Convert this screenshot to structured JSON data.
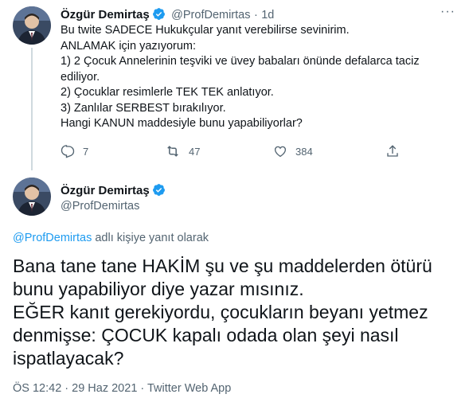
{
  "tweet1": {
    "name": "Özgür Demirtaş",
    "handle": "@ProfDemirtas",
    "separator": "·",
    "time": "1d",
    "lines": [
      "Bu twite SADECE Hukukçular yanıt verebilirse sevinirim.",
      "ANLAMAK için yazıyorum:",
      "1) 2 Çocuk Annelerinin teşviki ve üvey babaları önünde defalarca taciz",
      "ediliyor.",
      "2) Çocuklar resimlerle TEK TEK anlatıyor.",
      "3) Zanlılar SERBEST bırakılıyor.",
      "Hangi KANUN maddesiyle bunu yapabiliyorlar?"
    ],
    "reply_count": "7",
    "retweet_count": "47",
    "like_count": "384",
    "more_icon": "···"
  },
  "tweet2": {
    "name": "Özgür Demirtaş",
    "handle": "@ProfDemirtas",
    "reply_to_user": "@ProfDemirtas",
    "reply_to_suffix": "adlı kişiye yanıt olarak",
    "lines": [
      "Bana tane tane HAKİM şu ve şu maddelerden ötürü",
      "bunu yapabiliyor diye yazar mısınız.",
      "EĞER kanıt gerekiyordu, çocukların beyanı yetmez",
      "denmişse: ÇOCUK kapalı odada olan şeyi nasıl",
      "ispatlayacak?"
    ],
    "meta": "ÖS 12:42 · 29 Haz 2021 · Twitter Web App"
  },
  "colors": {
    "verified": "#1d9bf0",
    "link": "#1d9bf0",
    "muted": "#536471"
  }
}
